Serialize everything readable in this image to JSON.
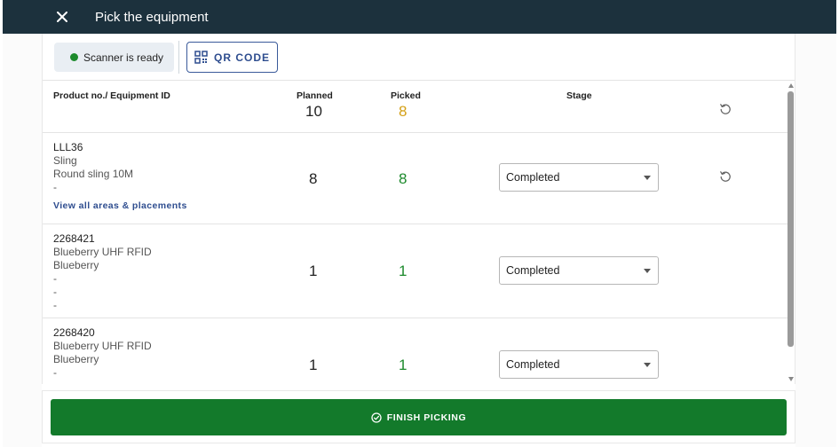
{
  "header": {
    "title": "Pick the equipment",
    "close_icon": "close-icon"
  },
  "scanner": {
    "status_text": "Scanner is ready",
    "status_color": "#1c8a2c",
    "qr_label": "QR CODE",
    "qr_icon": "qr-code-icon"
  },
  "table": {
    "columns": {
      "product": "Product no./ Equipment ID",
      "planned": "Planned",
      "picked": "Picked",
      "stage": "Stage"
    },
    "totals": {
      "planned": "10",
      "picked": "8"
    },
    "reset_icon": "reset-icon",
    "rows": [
      {
        "lines": [
          "LLL36",
          "Sling",
          "Round sling 10M",
          "-"
        ],
        "link": "View all areas & placements",
        "planned": "8",
        "picked": "8",
        "stage": "Completed",
        "has_reset": true
      },
      {
        "lines": [
          "2268421",
          "Blueberry UHF RFID",
          "Blueberry",
          "-",
          "-",
          "-"
        ],
        "planned": "1",
        "picked": "1",
        "stage": "Completed",
        "has_reset": false
      },
      {
        "lines": [
          "2268420",
          "Blueberry UHF RFID",
          "Blueberry",
          "-"
        ],
        "planned": "1",
        "picked": "1",
        "stage": "Completed",
        "has_reset": false
      }
    ]
  },
  "footer": {
    "finish_label": "FINISH PICKING",
    "finish_icon": "check-circle-icon",
    "button_color": "#137a2b"
  },
  "colors": {
    "topbar": "#1c313d",
    "picked_total": "#d4a017",
    "picked_row": "#1c8a2c",
    "link": "#2e4d8f"
  }
}
